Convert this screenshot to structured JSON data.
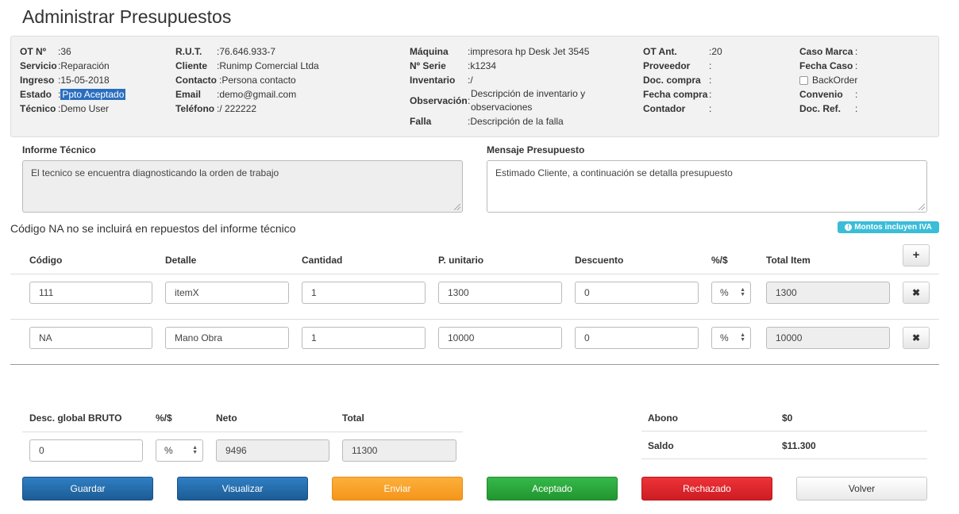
{
  "page": {
    "title": "Administrar Presupuestos"
  },
  "info": {
    "ot_label": "OT Nº",
    "ot_value": ":36",
    "servicio_label": "Servicio",
    "servicio_value": ":Reparación",
    "ingreso_label": "Ingreso",
    "ingreso_value": ":15-05-2018",
    "estado_label": "Estado",
    "estado_sep": ":",
    "estado_value": "Ppto Aceptado",
    "tecnico_label": "Técnico",
    "tecnico_value": ":Demo User",
    "rut_label": "R.U.T.",
    "rut_value": ":76.646.933-7",
    "cliente_label": "Cliente",
    "cliente_value": ":Runimp Comercial Ltda",
    "contacto_label": "Contacto",
    "contacto_value": ":Persona contacto",
    "email_label": "Email",
    "email_value": ":demo@gmail.com",
    "telefono_label": "Teléfono",
    "telefono_value": ":/ 222222",
    "maquina_label": "Máquina",
    "maquina_value": ":impresora hp Desk Jet 3545",
    "serie_label": "Nº Serie",
    "serie_value": ":k1234",
    "inventario_label": "Inventario",
    "inventario_value": ":/",
    "observacion_label": "Observación",
    "observacion_sep": ":",
    "observacion_line1": "Descripción de inventario y",
    "observacion_line2": "observaciones",
    "falla_label": "Falla",
    "falla_value": ":Descripción de la falla",
    "ot_ant_label": "OT Ant.",
    "ot_ant_value": ":20",
    "proveedor_label": "Proveedor",
    "proveedor_value": ":",
    "doc_compra_label": "Doc. compra",
    "doc_compra_value": ":",
    "fecha_compra_label": "Fecha compra",
    "fecha_compra_value": ":",
    "contador_label": "Contador",
    "contador_value": ":",
    "caso_marca_label": "Caso Marca",
    "caso_marca_value": ":",
    "fecha_caso_label": "Fecha Caso",
    "fecha_caso_value": ":",
    "backorder_label": "BackOrder",
    "convenio_label": "Convenio",
    "convenio_value": ":",
    "doc_ref_label": "Doc. Ref.",
    "doc_ref_value": ":"
  },
  "informe": {
    "label": "Informe Técnico",
    "text": "El tecnico se encuentra diagnosticando la orden de trabajo"
  },
  "mensaje": {
    "label": "Mensaje Presupuesto",
    "text": "Estimado Cliente, a continuación se detalla presupuesto"
  },
  "note": "Código NA no se incluirá en repuestos del informe técnico",
  "iva_badge": "Montos incluyen IVA",
  "table": {
    "headers": {
      "codigo": "Código",
      "detalle": "Detalle",
      "cantidad": "Cantidad",
      "unitario": "P. unitario",
      "descuento": "Descuento",
      "tipo": "%/$",
      "total": "Total Item"
    },
    "add_icon": "+",
    "remove_icon": "✖",
    "rows": [
      {
        "codigo": "111",
        "detalle": "itemX",
        "cantidad": "1",
        "unitario": "1300",
        "descuento": "0",
        "tipo": "%",
        "total": "1300"
      },
      {
        "codigo": "NA",
        "detalle": "Mano Obra",
        "cantidad": "1",
        "unitario": "10000",
        "descuento": "0",
        "tipo": "%",
        "total": "10000"
      }
    ]
  },
  "summary": {
    "desc_label": "Desc. global BRUTO",
    "tipo_label": "%/$",
    "neto_label": "Neto",
    "total_label": "Total",
    "desc_value": "0",
    "tipo_value": "%",
    "neto_value": "9496",
    "total_value": "11300",
    "abono_label": "Abono",
    "abono_value": "$0",
    "saldo_label": "Saldo",
    "saldo_value": "$11.300"
  },
  "buttons": {
    "guardar": "Guardar",
    "visualizar": "Visualizar",
    "enviar": "Enviar",
    "aceptado": "Aceptado",
    "rechazado": "Rechazado",
    "volver": "Volver"
  }
}
